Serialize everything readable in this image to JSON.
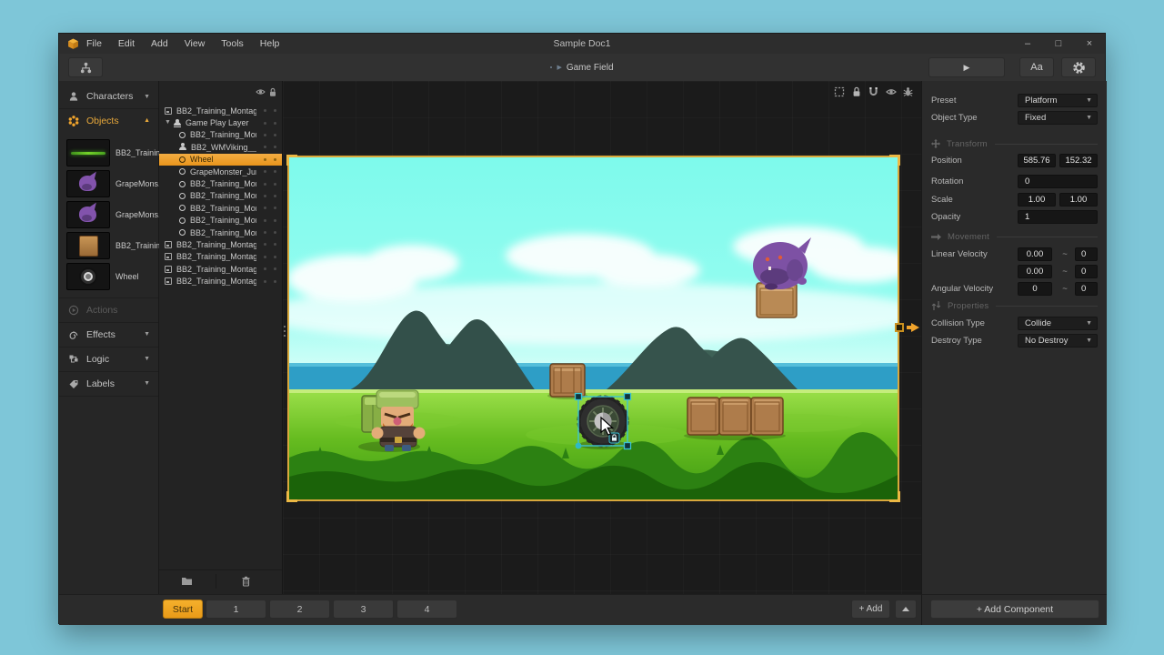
{
  "colors": {
    "accent_orange": "#F0A42C",
    "selection_teal": "#3CC3D2",
    "desktop_teal": "#7EC6D8",
    "scene_border": "#D9A83C",
    "sky_cyan": "#7EFAEC"
  },
  "titlebar": {
    "title": "Sample Doc1",
    "menus": [
      {
        "label": "File"
      },
      {
        "label": "Edit"
      },
      {
        "label": "Add"
      },
      {
        "label": "View"
      },
      {
        "label": "Tools"
      },
      {
        "label": "Help"
      }
    ],
    "controls": {
      "minimize": "–",
      "maximize": "□",
      "close": "×"
    }
  },
  "toolbar": {
    "breadcrumb": "Game Field",
    "font_button": "Aa"
  },
  "sidebar": {
    "sections": [
      {
        "label": "Characters"
      },
      {
        "label": "Objects"
      },
      {
        "label": "Actions"
      },
      {
        "label": "Effects"
      },
      {
        "label": "Logic"
      },
      {
        "label": "Labels"
      }
    ],
    "assets": [
      {
        "label": "BB2_Trainin...",
        "thumb": "grass"
      },
      {
        "label": "GrapeMons...",
        "thumb": "monster"
      },
      {
        "label": "GrapeMons...",
        "thumb": "monster"
      },
      {
        "label": "BB2_Trainin...",
        "thumb": "crate"
      },
      {
        "label": "Wheel",
        "thumb": "wheel"
      }
    ]
  },
  "layers": {
    "rows": [
      {
        "label": "BB2_Training_Montage...",
        "icon": "image",
        "depth": 0
      },
      {
        "label": "Game Play Layer",
        "icon": "layer",
        "depth": 0,
        "state": "expanded"
      },
      {
        "label": "BB2_Training_Monta...",
        "icon": "ring",
        "depth": 1
      },
      {
        "label": "BB2_WMViking__00...",
        "icon": "person",
        "depth": 1
      },
      {
        "label": "Wheel",
        "icon": "ring",
        "depth": 1,
        "selected": true
      },
      {
        "label": "GrapeMonster_Jum...",
        "icon": "ring",
        "depth": 1
      },
      {
        "label": "BB2_Training_Monta...",
        "icon": "ring",
        "depth": 1
      },
      {
        "label": "BB2_Training_Monta...",
        "icon": "ring",
        "depth": 1
      },
      {
        "label": "BB2_Training_Monta...",
        "icon": "ring",
        "depth": 1
      },
      {
        "label": "BB2_Training_Monta...",
        "icon": "ring",
        "depth": 1
      },
      {
        "label": "BB2_Training_Monta...",
        "icon": "ring",
        "depth": 1
      },
      {
        "label": "BB2_Training_Montage...",
        "icon": "image",
        "depth": 0
      },
      {
        "label": "BB2_Training_Montage...",
        "icon": "image",
        "depth": 0
      },
      {
        "label": "BB2_Training_Montage...",
        "icon": "image",
        "depth": 0
      },
      {
        "label": "BB2_Training_Montage...",
        "icon": "image",
        "depth": 0
      }
    ]
  },
  "inspector": {
    "preset": {
      "label": "Preset",
      "value": "Platform"
    },
    "object_type": {
      "label": "Object Type",
      "value": "Fixed"
    },
    "transform": {
      "title": "Transform",
      "position_label": "Position",
      "position_x": "585.76",
      "position_y": "152.32",
      "rotation_label": "Rotation",
      "rotation": "0",
      "scale_label": "Scale",
      "scale_x": "1.00",
      "scale_y": "1.00",
      "opacity_label": "Opacity",
      "opacity": "1"
    },
    "movement": {
      "title": "Movement",
      "linear_label": "Linear Velocity",
      "lin_x": "0.00",
      "lin_x_max": "0",
      "lin_y": "0.00",
      "lin_y_max": "0",
      "angular_label": "Angular Velocity",
      "ang": "0",
      "ang_max": "0",
      "range_sep": "~"
    },
    "properties": {
      "title": "Properties",
      "collision_label": "Collision Type",
      "collision_value": "Collide",
      "destroy_label": "Destroy Type",
      "destroy_value": "No Destroy"
    },
    "add_component_label": "+ Add Component"
  },
  "bottombar": {
    "tabs": [
      {
        "label": "Start",
        "active": true
      },
      {
        "label": "1"
      },
      {
        "label": "2"
      },
      {
        "label": "3"
      },
      {
        "label": "4"
      }
    ],
    "add_label": "+ Add"
  }
}
